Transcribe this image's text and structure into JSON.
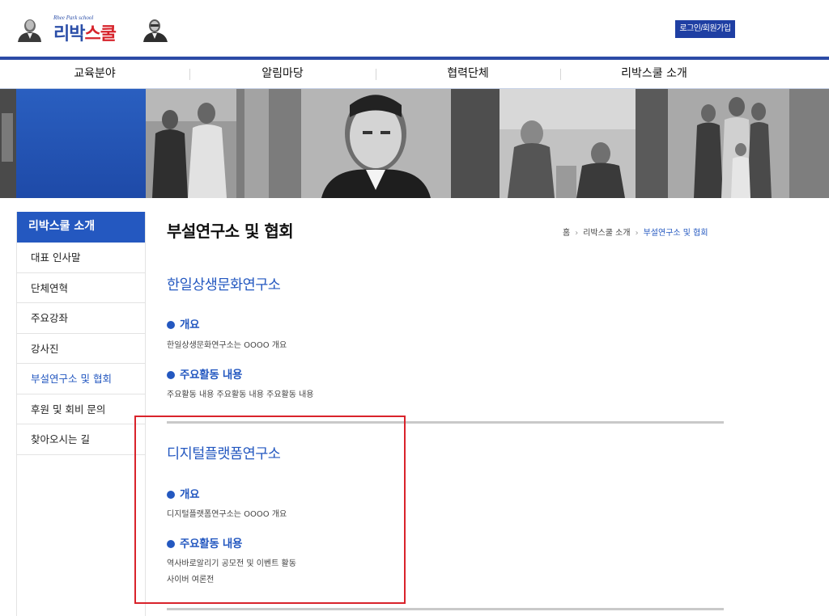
{
  "header": {
    "logo_sub": "Rhee Park school",
    "logo_main_part1": "리박",
    "logo_main_part2": "스쿨",
    "login_label": "로그인/회원가입"
  },
  "nav": {
    "items": [
      "교육분야",
      "알림마당",
      "협력단체",
      "리박스쿨 소개"
    ]
  },
  "sidebar": {
    "heading": "리박스쿨 소개",
    "items": [
      "대표 인사말",
      "단체연혁",
      "주요강좌",
      "강사진",
      "부설연구소 및 협회",
      "후원 및 회비 문의",
      "찾아오시는 길"
    ],
    "active_index": 4
  },
  "page": {
    "title": "부설연구소 및 협회",
    "breadcrumb": [
      "홈",
      "리박스쿨 소개",
      "부설연구소 및 협회"
    ]
  },
  "sections": [
    {
      "title": "한일상생문화연구소",
      "overview_label": "개요",
      "overview_text": "한일상생문화연구소는 OOOO 개요",
      "activities_label": "주요활동 내용",
      "activities_lines": [
        "주요활동 내용 주요활동 내용 주요활동 내용"
      ]
    },
    {
      "title": "디지털플랫폼연구소",
      "overview_label": "개요",
      "overview_text": "디지털플랫폼연구소는 OOOO 개요",
      "activities_label": "주요활동 내용",
      "activities_lines": [
        "역사바로알리기 공모전 및 이벤트 활동",
        "사이버 여론전"
      ]
    }
  ],
  "colors": {
    "brand_blue": "#2458c0",
    "header_line": "#2c4ba6",
    "highlight_red": "#d9232b"
  }
}
